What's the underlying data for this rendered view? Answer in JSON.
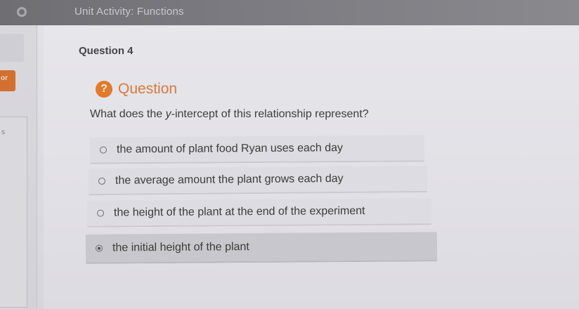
{
  "header": {
    "title": "Unit Activity: Functions",
    "logo_icon": "circle-logo-icon"
  },
  "sidebar": {
    "tab_fragment": "or",
    "card_fragment": "s"
  },
  "question": {
    "number_label": "Question 4",
    "section_label": "Question",
    "help_icon": "question-mark-icon",
    "help_symbol": "?",
    "prompt": "What does the y-intercept of this relationship represent?",
    "options": [
      {
        "label": "the amount of plant food Ryan uses each day",
        "selected": false
      },
      {
        "label": "the average amount the plant grows each day",
        "selected": false
      },
      {
        "label": "the height of the plant at the end of the experiment",
        "selected": false
      },
      {
        "label": "the initial height of the plant",
        "selected": true
      }
    ]
  },
  "colors": {
    "accent": "#e07a2c",
    "header_bg": "#7b7a80",
    "selected_option_bg": "#c8c7cd"
  }
}
